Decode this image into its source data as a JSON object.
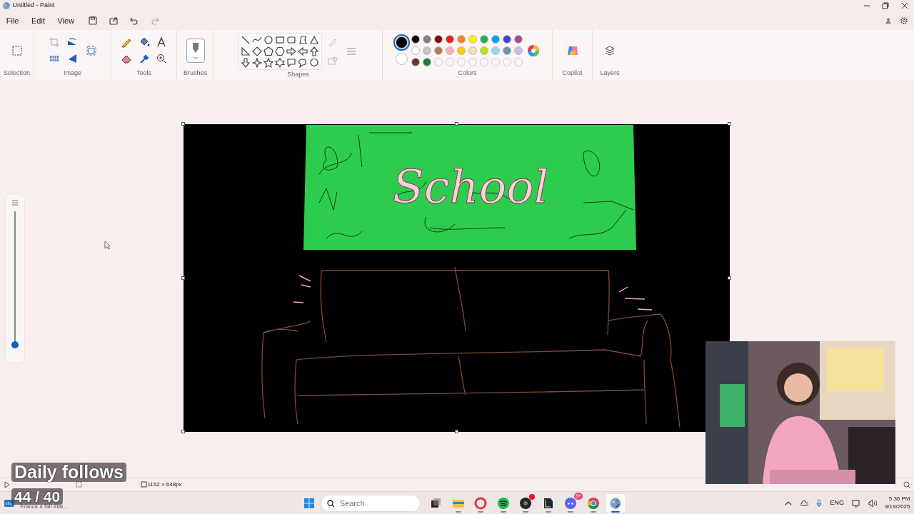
{
  "window": {
    "title": "Untitled - Paint"
  },
  "menu": [
    {
      "label": "File"
    },
    {
      "label": "Edit"
    },
    {
      "label": "View"
    }
  ],
  "quick_actions": [
    {
      "kind": "save",
      "disabled": false
    },
    {
      "kind": "share",
      "disabled": false
    },
    {
      "kind": "undo",
      "disabled": false
    },
    {
      "kind": "redo",
      "disabled": true
    }
  ],
  "ribbon": {
    "selection": {
      "label": "Selection"
    },
    "image": {
      "label": "Image"
    },
    "tools": {
      "label": "Tools"
    },
    "brushes": {
      "label": "Brushes"
    },
    "shapes": {
      "label": "Shapes"
    },
    "colors": {
      "label": "Colors",
      "current": [
        {
          "color": "#000000",
          "selected": true
        },
        {
          "color": "#ffffff",
          "selected": false
        }
      ],
      "palette": [
        {
          "kind": "swatch",
          "color": "#000000"
        },
        {
          "kind": "swatch",
          "color": "#7f7f7f"
        },
        {
          "kind": "swatch",
          "color": "#880015"
        },
        {
          "kind": "swatch",
          "color": "#ed1c24"
        },
        {
          "kind": "swatch",
          "color": "#ff7f27"
        },
        {
          "kind": "swatch",
          "color": "#fff200"
        },
        {
          "kind": "swatch",
          "color": "#22b14c"
        },
        {
          "kind": "swatch",
          "color": "#00a2e8"
        },
        {
          "kind": "swatch",
          "color": "#3f48cc"
        },
        {
          "kind": "swatch",
          "color": "#a349a4"
        },
        {
          "kind": "swatch",
          "color": "#ffffff"
        },
        {
          "kind": "swatch",
          "color": "#c3c3c3"
        },
        {
          "kind": "swatch",
          "color": "#b97a57"
        },
        {
          "kind": "swatch",
          "color": "#ffaec9"
        },
        {
          "kind": "swatch",
          "color": "#ffc90e"
        },
        {
          "kind": "swatch",
          "color": "#efe4b0"
        },
        {
          "kind": "swatch",
          "color": "#b5e61d"
        },
        {
          "kind": "swatch",
          "color": "#99d9ea"
        },
        {
          "kind": "swatch",
          "color": "#7092be"
        },
        {
          "kind": "swatch",
          "color": "#c8bfe7"
        },
        {
          "kind": "swatch",
          "color": "#5a3a2a"
        },
        {
          "kind": "swatch",
          "color": "#1e7a35"
        },
        {
          "kind": "empty"
        },
        {
          "kind": "empty"
        },
        {
          "kind": "empty"
        },
        {
          "kind": "empty"
        },
        {
          "kind": "empty"
        },
        {
          "kind": "empty"
        },
        {
          "kind": "empty"
        },
        {
          "kind": "empty"
        }
      ]
    },
    "copilot": {
      "label": "Copilot"
    },
    "layers": {
      "label": "Layers"
    }
  },
  "canvas": {
    "caption": "School"
  },
  "zoom_slider": {
    "level": 0
  },
  "status_bar": {
    "canvas_size": "1152 × 648px"
  },
  "overlay": {
    "title": "Daily follows",
    "count": "44 / 40"
  },
  "notification": {
    "text": "France a fait état..."
  },
  "taskbar": {
    "search": {
      "placeholder": "Search"
    },
    "apps": [
      {
        "kind": "taskview",
        "running": false,
        "selected": false
      },
      {
        "kind": "explorer",
        "running": true,
        "selected": false
      },
      {
        "kind": "opera",
        "running": true,
        "selected": false
      },
      {
        "kind": "spotify",
        "running": true,
        "selected": false
      },
      {
        "kind": "obs",
        "running": true,
        "selected": false,
        "dot": true
      },
      {
        "kind": "league",
        "running": true,
        "selected": false
      },
      {
        "kind": "discord",
        "running": true,
        "selected": false,
        "badge": "9+"
      },
      {
        "kind": "chrome",
        "running": true,
        "selected": false
      },
      {
        "kind": "paint",
        "running": true,
        "selected": true
      }
    ],
    "language": "ENG",
    "time": "5:36 PM",
    "date": "9/19/2025"
  }
}
